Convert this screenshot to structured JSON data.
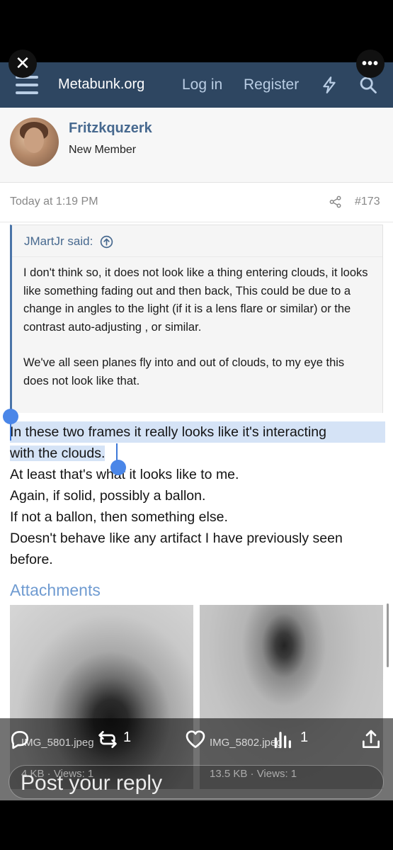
{
  "navbar": {
    "brand": "Metabunk.org",
    "login": "Log in",
    "register": "Register"
  },
  "overlay": {
    "close_icon": "✕",
    "more_icon": "•••"
  },
  "author": {
    "name": "Fritzkquzerk",
    "role": "New Member"
  },
  "post": {
    "time": "Today at 1:19 PM",
    "number": "#173",
    "quote": {
      "author": "JMartJr said:",
      "paragraph1": "I don't think so, it does not look like a thing entering clouds, it looks like something fading out and then back, This could be due to a change in angles to the light (if it is a lens flare or similar) or the contrast auto-adjusting , or similar.",
      "paragraph2": "We've all seen planes fly into and out of clouds, to my eye this does not look like that."
    },
    "lines": [
      "In these two frames it really looks like it's interacting",
      "with the clouds.",
      "At least that's what it looks like to me.",
      "Again, if solid, possibly a ballon.",
      "If not a ballon, then something else.",
      "Doesn't behave like any artifact I have previously seen",
      "before."
    ]
  },
  "attachments": {
    "title": "Attachments",
    "items": [
      {
        "name": "IMG_5801.jpeg",
        "stats": "4 KB · Views: 1"
      },
      {
        "name": "IMG_5802.jpeg",
        "stats": "13.5 KB · Views: 1"
      }
    ]
  },
  "tweet_actions": {
    "retweets": "1",
    "views": "1",
    "reply_placeholder": "Post your reply"
  },
  "colors": {
    "navbar": "#2e4661",
    "link": "#47698f",
    "selection": "#d5e3f6",
    "handle": "#4a86e8"
  }
}
